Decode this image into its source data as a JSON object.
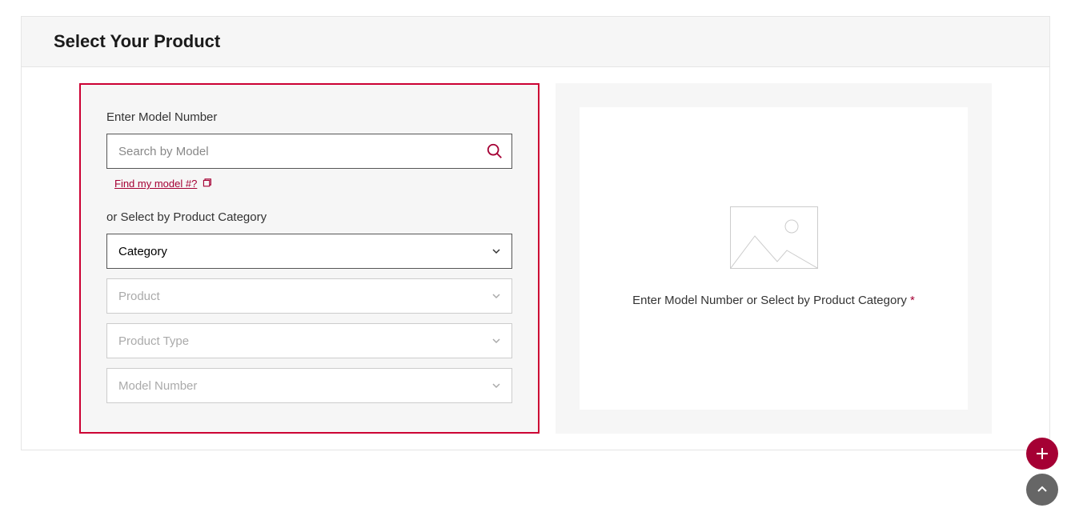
{
  "header": {
    "title": "Select Your Product"
  },
  "form": {
    "model_label": "Enter Model Number",
    "search_placeholder": "Search by Model",
    "find_link": "Find my model #?",
    "category_label": "or Select by Product Category",
    "selects": {
      "category": "Category",
      "product": "Product",
      "product_type": "Product Type",
      "model_number": "Model Number"
    }
  },
  "preview": {
    "text": "Enter Model Number or Select by Product Category",
    "required_mark": "*"
  }
}
